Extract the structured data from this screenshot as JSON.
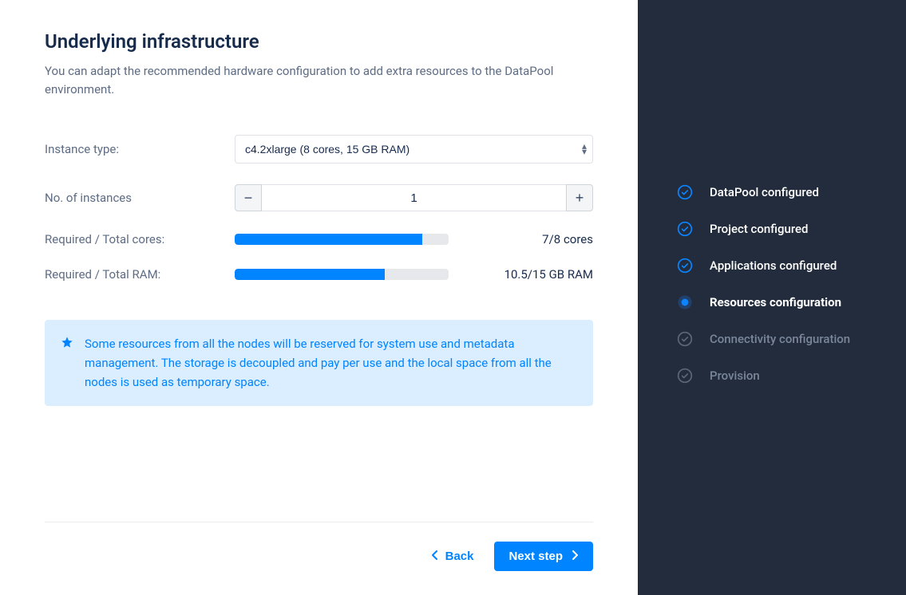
{
  "header": {
    "title": "Underlying infrastructure",
    "subtitle": "You can adapt the recommended hardware configuration to add extra resources to the DataPool environment."
  },
  "form": {
    "instance_type_label": "Instance type:",
    "instance_type_value": "c4.2xlarge (8 cores, 15 GB RAM)",
    "instances_label": "No. of instances",
    "instances_value": "1",
    "cores_label": "Required / Total cores:",
    "cores_value": "7/8 cores",
    "cores_pct": 87.5,
    "ram_label": "Required / Total RAM:",
    "ram_value": "10.5/15 GB RAM",
    "ram_pct": 70
  },
  "info": {
    "text": "Some resources from all the nodes will be reserved for system use and metadata management. The storage is decoupled and pay per use and the local space from all the nodes is used as temporary space."
  },
  "footer": {
    "back_label": "Back",
    "next_label": "Next step"
  },
  "sidebar": {
    "steps": [
      {
        "label": "DataPool configured",
        "state": "done"
      },
      {
        "label": "Project configured",
        "state": "done"
      },
      {
        "label": "Applications configured",
        "state": "done"
      },
      {
        "label": "Resources configuration",
        "state": "current"
      },
      {
        "label": "Connectivity configuration",
        "state": "pending"
      },
      {
        "label": "Provision",
        "state": "pending"
      }
    ]
  },
  "colors": {
    "accent": "#0084ff",
    "sidebar_bg": "#222c3c"
  }
}
